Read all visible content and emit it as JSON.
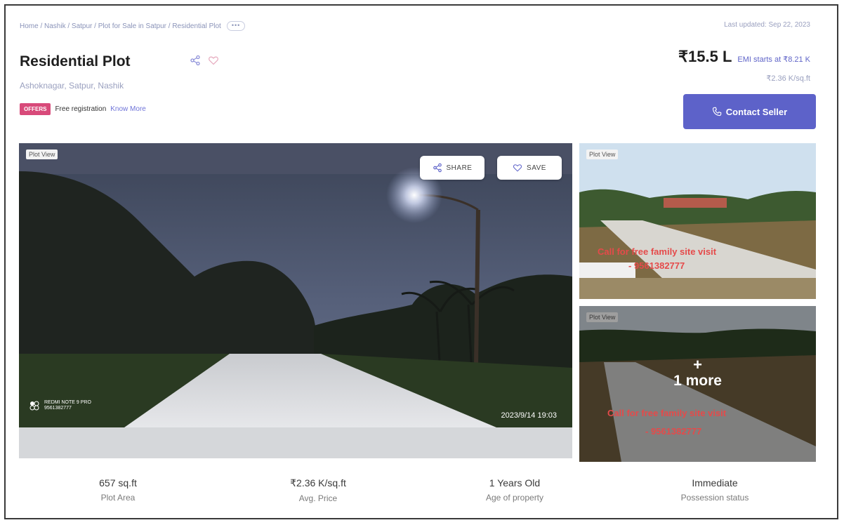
{
  "breadcrumb": {
    "text": "Home / Nashik / Satpur / Plot for Sale in Satpur / Residential Plot",
    "more": "•••"
  },
  "last_updated": "Last updated: Sep 22, 2023",
  "title": "Residential Plot",
  "locality": "Ashoknagar, Satpur, Nashik",
  "offers": {
    "badge": "OFFERS",
    "text": "Free registration",
    "link": "Know More"
  },
  "price": {
    "amount": "₹15.5 L",
    "emi": "EMI starts at ₹8.21 K",
    "rate": "₹2.36 K/sq.ft"
  },
  "contact_button": "Contact Seller",
  "gallery": {
    "main_tag": "Plot View",
    "share_label": "SHARE",
    "save_label": "SAVE",
    "watermark_line1": "REDMI NOTE 9 PRO",
    "watermark_line2": "9561382777",
    "timestamp": "2023/9/14 19:03",
    "side1_tag": "Plot View",
    "side1_promo_line1": "Call for free family site visit",
    "side1_promo_line2": "- 9561382777",
    "side2_tag": "Plot View",
    "side2_plus": "+",
    "side2_more": "1 more",
    "side2_promo_line1": "Call for free family site visit",
    "side2_promo_line2": "- 9561382777"
  },
  "stats": [
    {
      "value": "657 sq.ft",
      "label": "Plot Area"
    },
    {
      "value": "₹2.36 K/sq.ft",
      "label": "Avg. Price"
    },
    {
      "value": "1 Years Old",
      "label": "Age of property"
    },
    {
      "value": "Immediate",
      "label": "Possession status"
    }
  ],
  "colors": {
    "accent": "#5d62c9",
    "offer_badge": "#d84a7a",
    "promo_text": "#e54a4a"
  }
}
